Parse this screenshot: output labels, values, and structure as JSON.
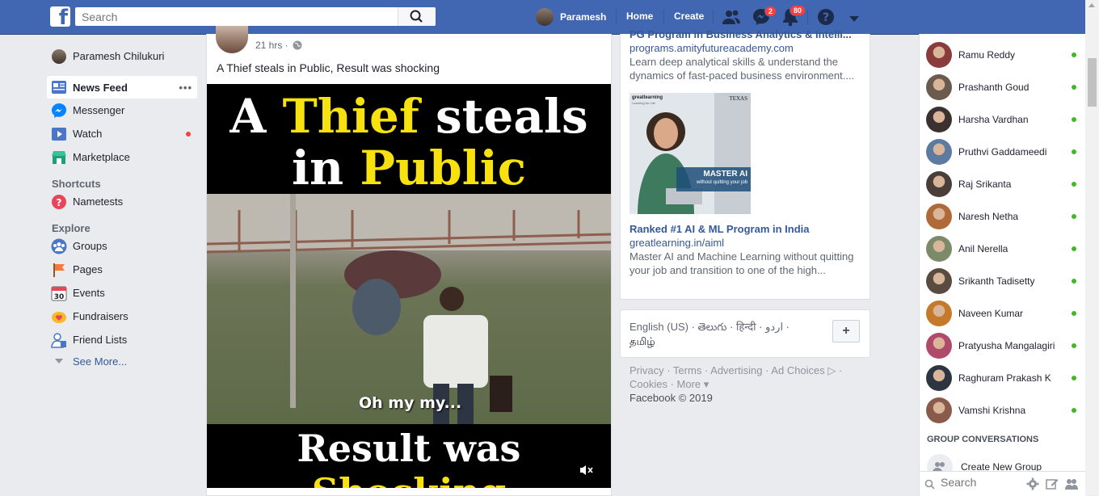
{
  "topbar": {
    "logo_letter": "f",
    "search_placeholder": "Search",
    "user_name": "Paramesh",
    "home_label": "Home",
    "create_label": "Create",
    "messages_badge": "2",
    "notifications_badge": "80"
  },
  "left_nav": {
    "profile_name": "Paramesh Chilukuri",
    "items": [
      {
        "label": "News Feed",
        "icon": "news-feed-icon"
      },
      {
        "label": "Messenger",
        "icon": "messenger-icon"
      },
      {
        "label": "Watch",
        "icon": "watch-icon"
      },
      {
        "label": "Marketplace",
        "icon": "marketplace-icon"
      }
    ],
    "shortcuts_heading": "Shortcuts",
    "shortcuts": [
      {
        "label": "Nametests",
        "icon": "nametests-icon"
      }
    ],
    "explore_heading": "Explore",
    "explore": [
      {
        "label": "Groups",
        "icon": "groups-icon"
      },
      {
        "label": "Pages",
        "icon": "pages-icon"
      },
      {
        "label": "Events",
        "icon": "events-icon"
      },
      {
        "label": "Fundraisers",
        "icon": "fundraisers-icon"
      },
      {
        "label": "Friend Lists",
        "icon": "friend-lists-icon"
      }
    ],
    "see_more": "See More...",
    "events_day": "30",
    "more_dots": "•••"
  },
  "post": {
    "time": "21 hrs ·",
    "text": "A Thief steals in Public, Result was shocking",
    "video": {
      "title_a": "A ",
      "title_thief": "Thief",
      "title_steals": " steals",
      "title_in": "in ",
      "title_public": "Public",
      "subtitle": "Oh my my...",
      "bottom_result": "Result was ",
      "bottom_shocking": "Shocking"
    }
  },
  "ads": [
    {
      "title": "PG Program in Business Analytics & Intelli...",
      "url": "programs.amityfutureacademy.com",
      "desc": "Learn deep analytical skills & understand the dynamics of fast-paced business environment...."
    },
    {
      "title": "Ranked #1 AI & ML Program in India",
      "url": "greatlearning.in/aiml",
      "desc": "Master AI and Machine Learning without quitting your job and transition to one of the high...",
      "image": {
        "brand": "greatlearning",
        "brand_sub": "Learning for Life",
        "partner": "TEXAS",
        "headline": "MASTER AI",
        "tagline": "without quitting your job"
      }
    }
  ],
  "languages": {
    "line1": "English (US) · తెలుగు · हिन्दी · اردو ·",
    "line2": "தமிழ்",
    "add": "+"
  },
  "footer": {
    "line1": "Privacy · Terms · Advertising · Ad Choices ▷ ·",
    "line2": "Cookies · More ▾",
    "copyright": "Facebook © 2019"
  },
  "chat": {
    "contacts": [
      {
        "name": "Ramu Reddy",
        "color": "#8a3b3b"
      },
      {
        "name": "Prashanth Goud",
        "color": "#6b5a4e"
      },
      {
        "name": "Harsha Vardhan",
        "color": "#3b3130"
      },
      {
        "name": "Pruthvi Gaddameedi",
        "color": "#5d7aa0"
      },
      {
        "name": "Raj Srikanta",
        "color": "#4a3f38"
      },
      {
        "name": "Naresh Netha",
        "color": "#b06a3a"
      },
      {
        "name": "Anil Nerella",
        "color": "#7c8a6a"
      },
      {
        "name": "Srikanth Tadisetty",
        "color": "#5a4b40"
      },
      {
        "name": "Naveen Kumar",
        "color": "#c47a2a"
      },
      {
        "name": "Pratyusha Mangalagiri",
        "color": "#b04a6a"
      },
      {
        "name": "Raghuram Prakash K",
        "color": "#2c3540"
      },
      {
        "name": "Vamshi Krishna",
        "color": "#8a5a4a"
      }
    ],
    "group_heading": "GROUP CONVERSATIONS",
    "create_group": "Create New Group",
    "search_placeholder": "Search"
  },
  "colors": {
    "brand": "#4267b2",
    "online": "#42b72a",
    "badge": "#fa3e3e"
  }
}
